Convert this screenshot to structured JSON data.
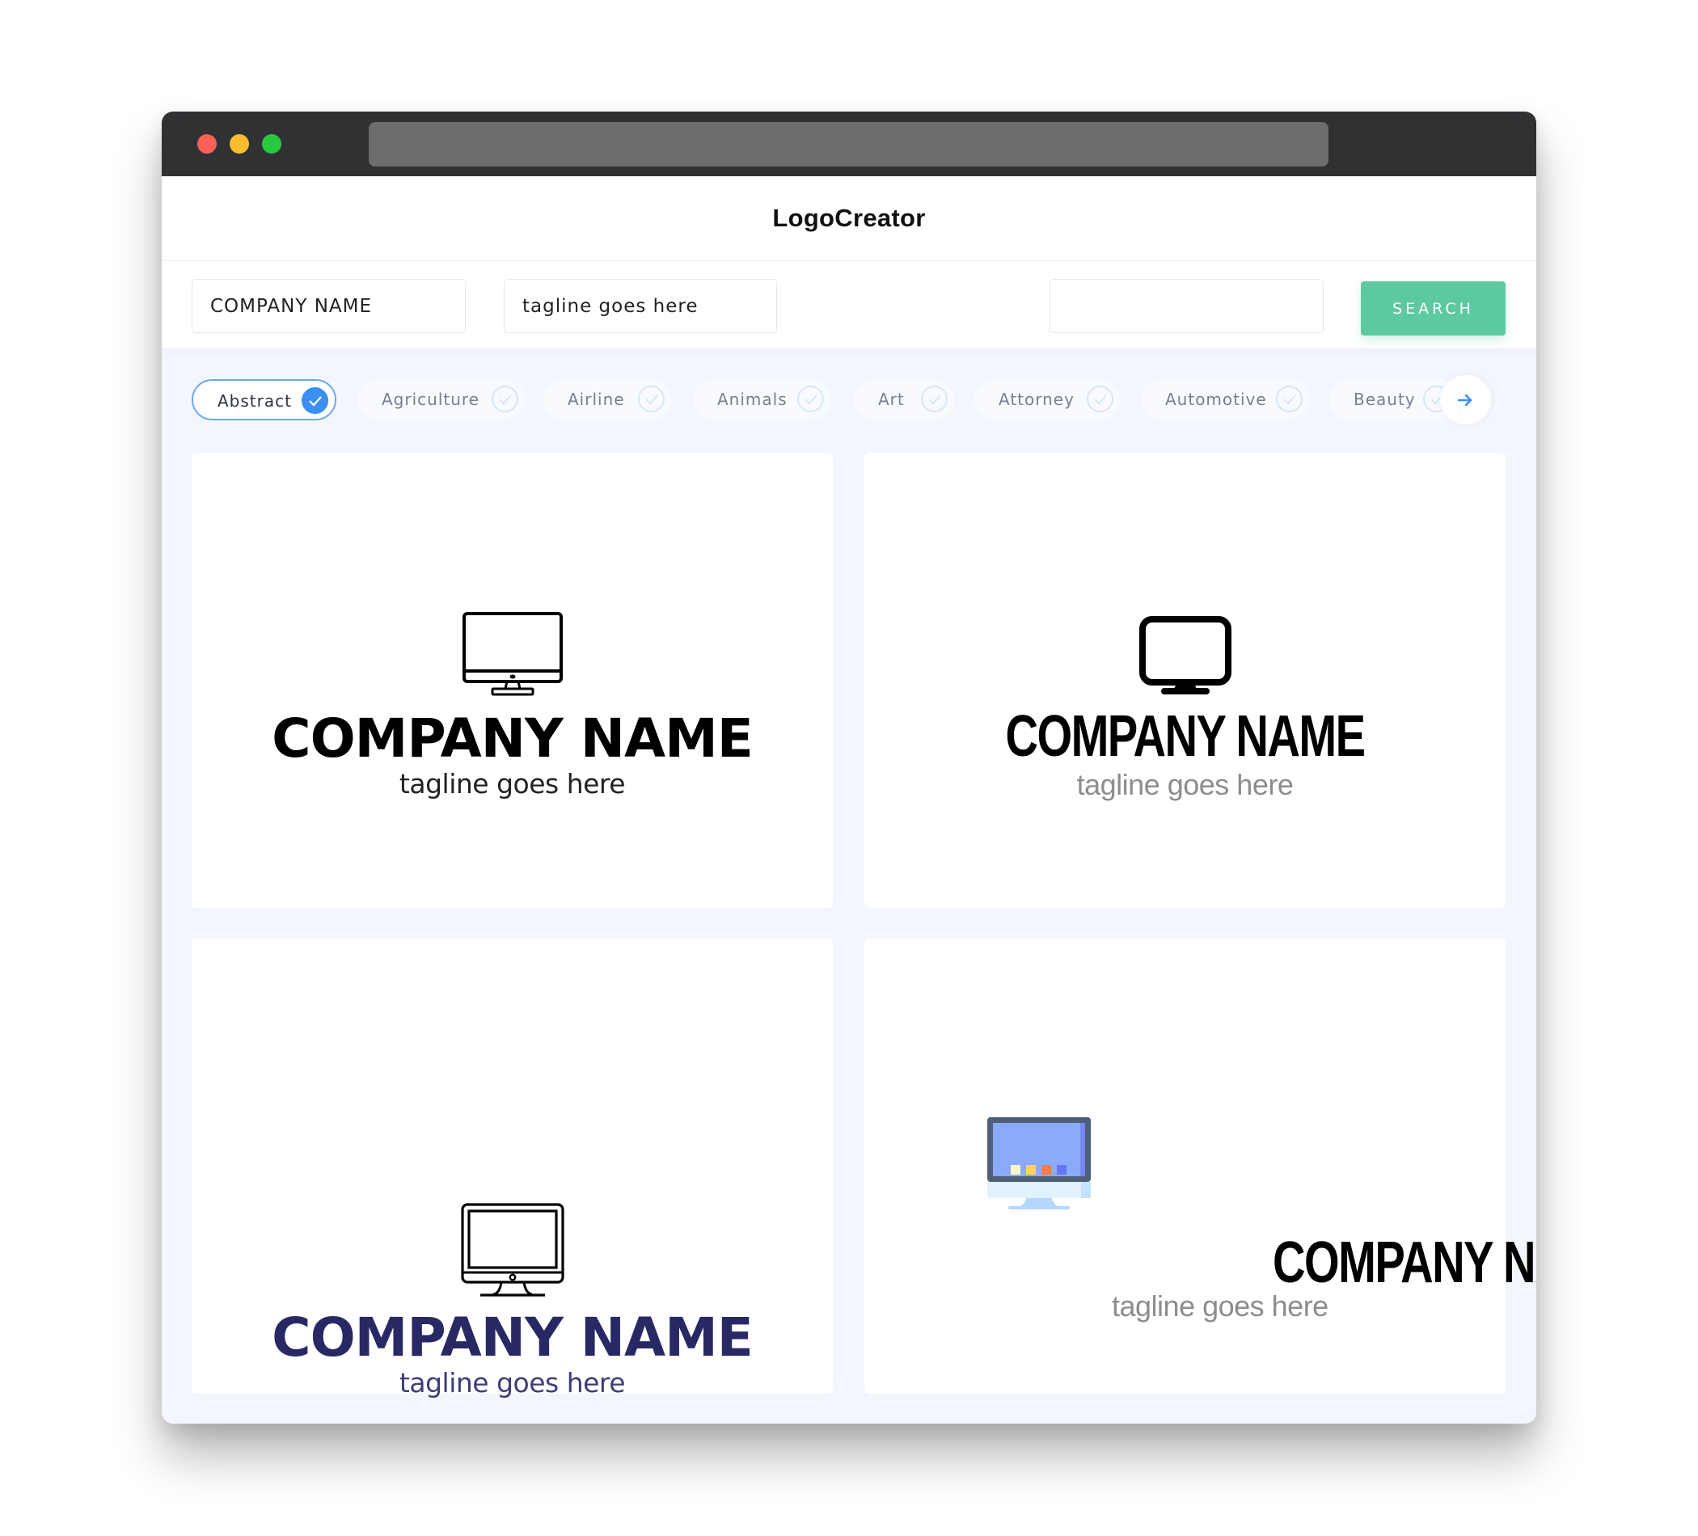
{
  "window": {
    "controls": [
      "close",
      "minimize",
      "maximize"
    ],
    "colors": {
      "close": "#fe5f57",
      "minimize": "#febc2e",
      "maximize": "#28c840",
      "titlebar": "#303133"
    }
  },
  "header": {
    "title": "LogoCreator"
  },
  "search": {
    "company_name_value": "COMPANY NAME",
    "tagline_value": "tagline goes here",
    "keyword_value": "",
    "button_label": "SEARCH",
    "button_color": "#5cc9a1"
  },
  "categories": {
    "items": [
      {
        "label": "Abstract",
        "selected": true
      },
      {
        "label": "Agriculture",
        "selected": false
      },
      {
        "label": "Airline",
        "selected": false
      },
      {
        "label": "Animals",
        "selected": false
      },
      {
        "label": "Art",
        "selected": false
      },
      {
        "label": "Attorney",
        "selected": false
      },
      {
        "label": "Automotive",
        "selected": false
      },
      {
        "label": "Beauty",
        "selected": false
      }
    ],
    "next_icon": "arrow-right-icon",
    "accent": "#3a8ff0"
  },
  "logos": [
    {
      "icon": "monitor-outline-icon",
      "name": "COMPANY NAME",
      "tagline": "tagline goes here",
      "name_color": "#000000",
      "tagline_color": "#222222"
    },
    {
      "icon": "monitor-solid-icon",
      "name": "COMPANY NAME",
      "tagline": "tagline goes here",
      "name_color": "#000000",
      "tagline_color": "#8d8d8d"
    },
    {
      "icon": "imac-outline-icon",
      "name": "COMPANY NAME",
      "tagline": "tagline goes here",
      "name_color": "#282865",
      "tagline_color": "#3d3d7a"
    },
    {
      "icon": "monitor-color-icon",
      "name": "COMPANY NAME",
      "tagline": "tagline goes here",
      "name_color": "#000000",
      "tagline_color": "#8d8d8d"
    }
  ]
}
